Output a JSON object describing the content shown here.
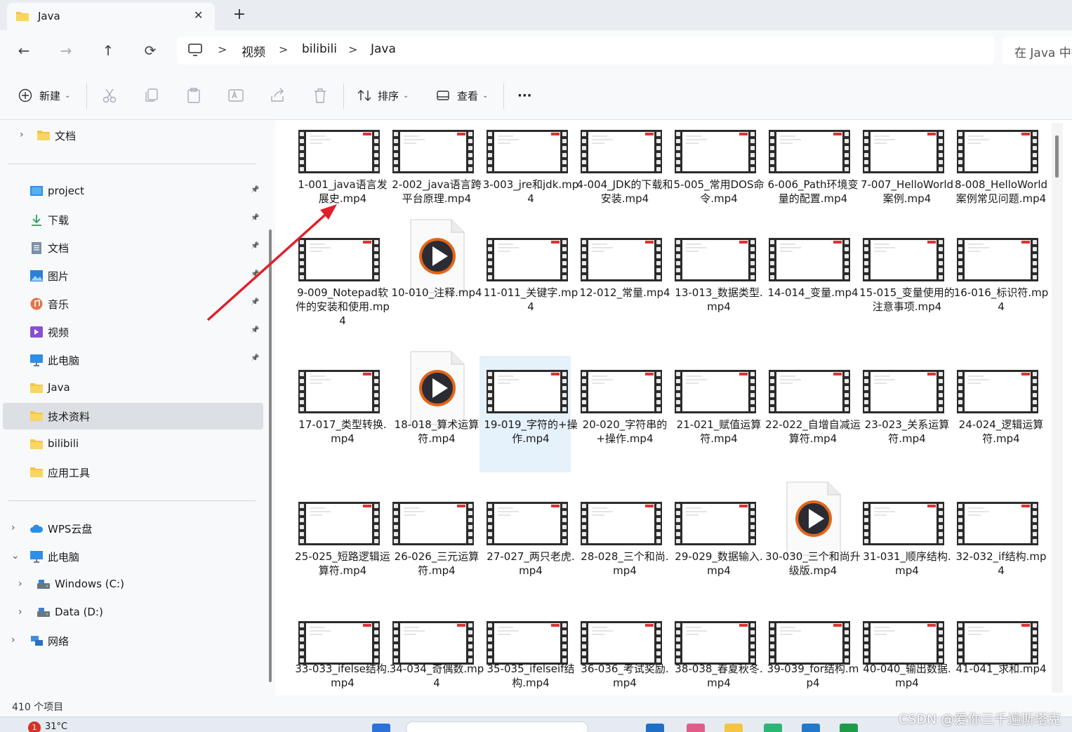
{
  "window": {
    "tab_title": "Java",
    "tab_close": "✕",
    "new_tab": "+"
  },
  "nav": {
    "back": "←",
    "forward": "→",
    "up": "↑",
    "refresh": "⟳",
    "breadcrumbs": [
      "视频",
      "bilibili",
      "Java"
    ],
    "crumb_separator": ">",
    "search_placeholder": "在 Java 中搜索"
  },
  "toolbar": {
    "new_label": "新建",
    "sort_label": "排序",
    "view_label": "查看",
    "more_label": "···",
    "icons": [
      "cut-icon",
      "copy-icon",
      "paste-icon",
      "rename-icon",
      "share-icon",
      "delete-icon"
    ]
  },
  "sidebar": {
    "top_items": [
      {
        "label": "文档",
        "icon": "folder-icon"
      }
    ],
    "pinned": [
      {
        "label": "project",
        "icon": "desktop-icon",
        "pinned": true
      },
      {
        "label": "下载",
        "icon": "download-icon",
        "pinned": true
      },
      {
        "label": "文档",
        "icon": "document-icon",
        "pinned": true
      },
      {
        "label": "图片",
        "icon": "picture-icon",
        "pinned": true
      },
      {
        "label": "音乐",
        "icon": "music-icon",
        "pinned": true
      },
      {
        "label": "视频",
        "icon": "video-icon",
        "pinned": true
      },
      {
        "label": "此电脑",
        "icon": "computer-icon",
        "pinned": true
      },
      {
        "label": "Java",
        "icon": "folder-icon",
        "pinned": false
      },
      {
        "label": "技术资料",
        "icon": "folder-icon",
        "pinned": false,
        "selected": true
      },
      {
        "label": "bilibili",
        "icon": "folder-icon",
        "pinned": false
      },
      {
        "label": "应用工具",
        "icon": "folder-icon",
        "pinned": false
      }
    ],
    "tree": [
      {
        "label": "WPS云盘",
        "icon": "cloud-icon",
        "chevron": ">"
      },
      {
        "label": "此电脑",
        "icon": "computer-icon",
        "chevron": "v"
      },
      {
        "label": "Windows (C:)",
        "icon": "drive-icon",
        "chevron": ">"
      },
      {
        "label": "Data (D:)",
        "icon": "drive-icon",
        "chevron": ">"
      },
      {
        "label": "网络",
        "icon": "network-icon",
        "chevron": ">"
      }
    ]
  },
  "files": [
    {
      "name": "1-001_java语言发展史.mp4",
      "kind": "film"
    },
    {
      "name": "2-002_java语言跨平台原理.mp4",
      "kind": "film"
    },
    {
      "name": "3-003_jre和jdk.mp4",
      "kind": "film"
    },
    {
      "name": "4-004_JDK的下载和安装.mp4",
      "kind": "film"
    },
    {
      "name": "5-005_常用DOS命令.mp4",
      "kind": "film"
    },
    {
      "name": "6-006_Path环境变量的配置.mp4",
      "kind": "film"
    },
    {
      "name": "7-007_HelloWorld案例.mp4",
      "kind": "film"
    },
    {
      "name": "8-008_HelloWorld案例常见问题.mp4",
      "kind": "film"
    },
    {
      "name": "9-009_Notepad软件的安装和使用.mp4",
      "kind": "film"
    },
    {
      "name": "10-010_注释.mp4",
      "kind": "video"
    },
    {
      "name": "11-011_关键字.mp4",
      "kind": "film"
    },
    {
      "name": "12-012_常量.mp4",
      "kind": "film"
    },
    {
      "name": "13-013_数据类型.mp4",
      "kind": "film"
    },
    {
      "name": "14-014_变量.mp4",
      "kind": "film"
    },
    {
      "name": "15-015_变量使用的注意事项.mp4",
      "kind": "film"
    },
    {
      "name": "16-016_标识符.mp4",
      "kind": "film"
    },
    {
      "name": "17-017_类型转换.mp4",
      "kind": "film"
    },
    {
      "name": "18-018_算术运算符.mp4",
      "kind": "video"
    },
    {
      "name": "19-019_字符的+操作.mp4",
      "kind": "film",
      "selected": true
    },
    {
      "name": "20-020_字符串的+操作.mp4",
      "kind": "film"
    },
    {
      "name": "21-021_赋值运算符.mp4",
      "kind": "film"
    },
    {
      "name": "22-022_自增自减运算符.mp4",
      "kind": "film"
    },
    {
      "name": "23-023_关系运算符.mp4",
      "kind": "film"
    },
    {
      "name": "24-024_逻辑运算符.mp4",
      "kind": "film"
    },
    {
      "name": "25-025_短路逻辑运算符.mp4",
      "kind": "film"
    },
    {
      "name": "26-026_三元运算符.mp4",
      "kind": "film"
    },
    {
      "name": "27-027_两只老虎.mp4",
      "kind": "film"
    },
    {
      "name": "28-028_三个和尚.mp4",
      "kind": "film"
    },
    {
      "name": "29-029_数据输入.mp4",
      "kind": "film"
    },
    {
      "name": "30-030_三个和尚升级版.mp4",
      "kind": "video"
    },
    {
      "name": "31-031_顺序结构.mp4",
      "kind": "film"
    },
    {
      "name": "32-032_if结构.mp4",
      "kind": "film"
    },
    {
      "name": "33-033_ifelse结构.mp4",
      "kind": "film"
    },
    {
      "name": "34-034_奇偶数.mp4",
      "kind": "film"
    },
    {
      "name": "35-035_ifelseif结构.mp4",
      "kind": "film"
    },
    {
      "name": "36-036_考试奖励.mp4",
      "kind": "film"
    },
    {
      "name": "38-038_春夏秋冬.mp4",
      "kind": "film"
    },
    {
      "name": "39-039_for结构.mp4",
      "kind": "film"
    },
    {
      "name": "40-040_输出数据.mp4",
      "kind": "film"
    },
    {
      "name": "41-041_求和.mp4",
      "kind": "film"
    }
  ],
  "status": {
    "item_count": "410 个项目"
  },
  "taskbar": {
    "weather_badge": "1",
    "temperature": "31°C"
  },
  "watermark": "CSDN @爱你三千遍斯塔克",
  "colors": {
    "selection": "#e5f1fb",
    "sidebar_selected": "#dcdfe3",
    "annotation_arrow": "#e0202a",
    "folder": "#f4c542"
  }
}
